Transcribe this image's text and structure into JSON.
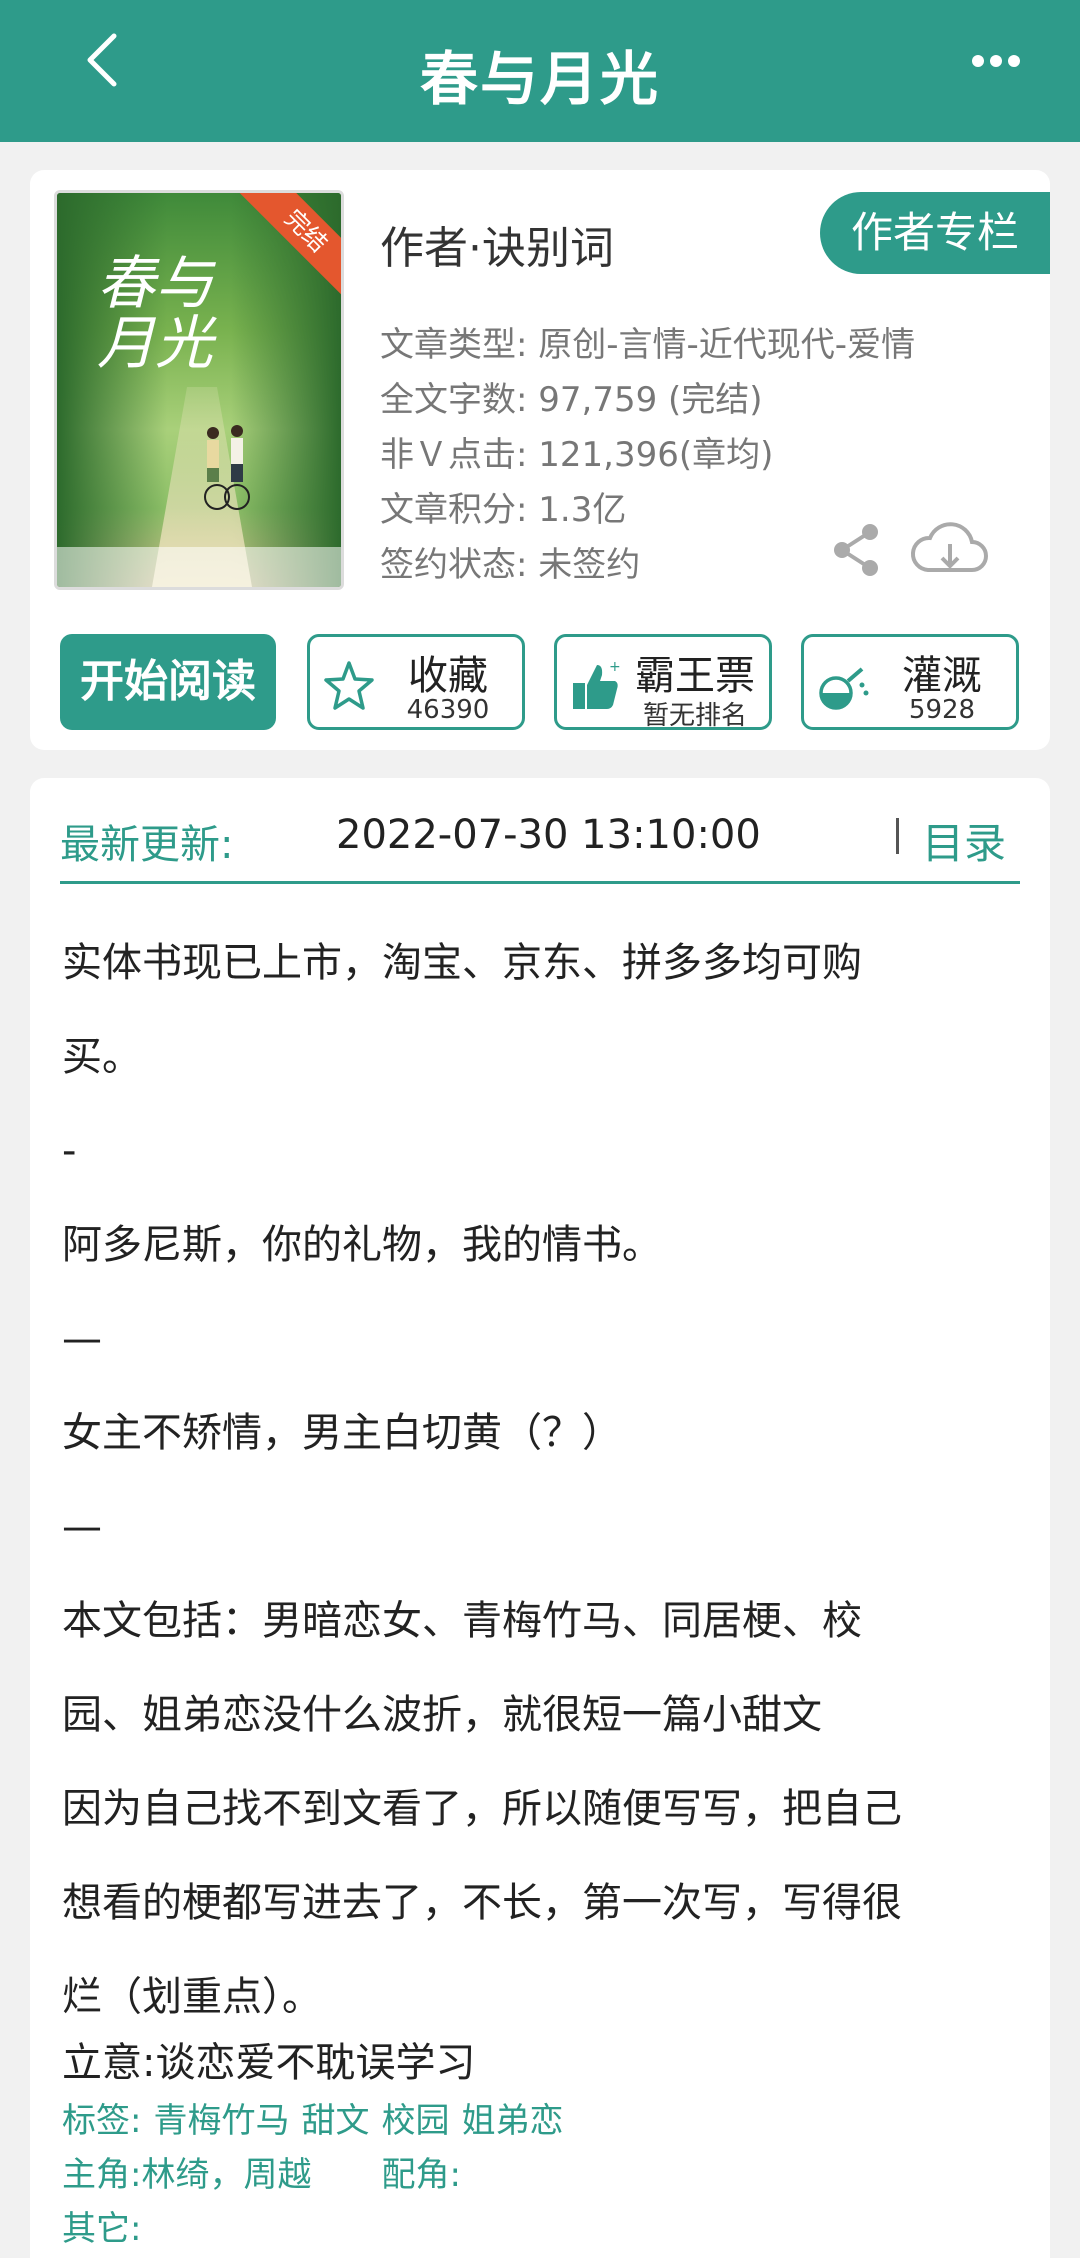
{
  "header": {
    "title": "春与月光"
  },
  "book": {
    "cover_title": "春与月光",
    "cover_badge": "完结",
    "author_line": "作者·诀别词",
    "author_column_button": "作者专栏",
    "meta": [
      "文章类型: 原创-言情-近代现代-爱情",
      "全文字数: 97,759 (完结)",
      "非Ｖ点击: 121,396(章均)",
      "文章积分: 1.3亿",
      "签约状态:  未签约"
    ]
  },
  "actions": {
    "start_reading": "开始阅读",
    "favorite": {
      "label": "收藏",
      "count": "46390"
    },
    "ticket": {
      "label": "霸王票",
      "sub": "暂无排名"
    },
    "nutrient": {
      "label": "灌溉",
      "count": "5928"
    }
  },
  "update": {
    "label": "最新更新:",
    "time": "2022-07-30 13:10:00",
    "toc": "目录"
  },
  "intro": {
    "lines": [
      "实体书现已上市，淘宝、京东、拼多多均可购",
      "买。",
      "-",
      "阿多尼斯，你的礼物，我的情书。",
      "—",
      "女主不矫情，男主白切黄（？）",
      "—",
      "本文包括：男暗恋女、青梅竹马、同居梗、校",
      "园、姐弟恋没什么波折，就很短一篇小甜文",
      "因为自己找不到文看了，所以随便写写，把自己",
      "想看的梗都写进去了，不长，第一次写，写得很",
      "烂（划重点）。"
    ],
    "intent": "立意:谈恋爱不耽误学习",
    "tags_label": "标签:",
    "tags": [
      "青梅竹马",
      "甜文",
      "校园",
      "姐弟恋"
    ],
    "main_roles_label": "主角:",
    "main_roles": "林绮，周越",
    "supporting_label": "配角:",
    "others_label": "其它:"
  },
  "colors": {
    "accent": "#2e9b8a",
    "badge": "#e4572e"
  },
  "icons": [
    "back-icon",
    "more-icon",
    "share-icon",
    "download-icon",
    "star-icon",
    "thumbs-up-icon",
    "watering-can-icon"
  ]
}
